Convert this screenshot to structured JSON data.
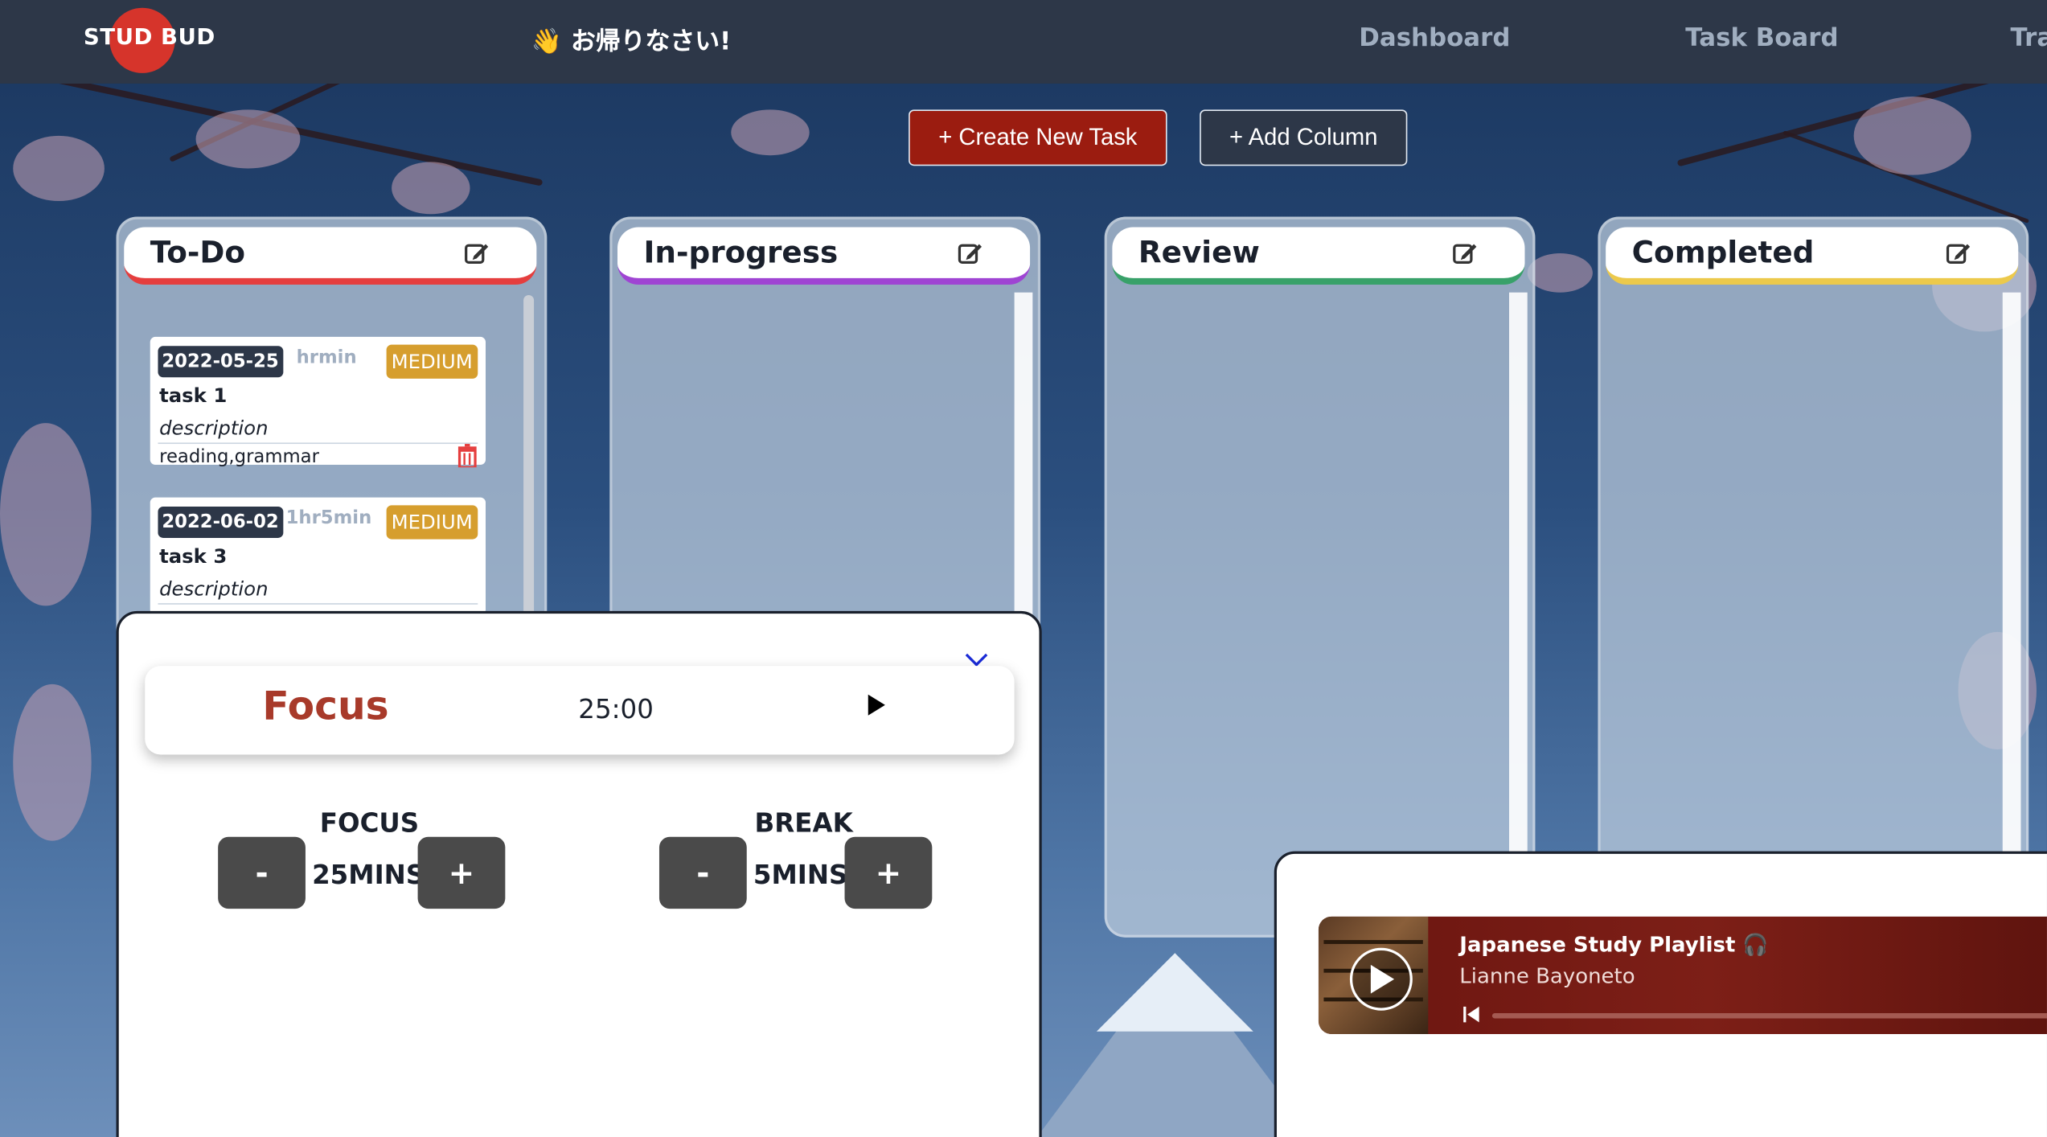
{
  "nav": {
    "logo": "STUD BUD",
    "welcome": "👋 お帰りなさい!",
    "links": [
      "Dashboard",
      "Task Board",
      "Tra"
    ]
  },
  "toolbar": {
    "create_label": "+ Create New Task",
    "add_column_label": "+ Add Column"
  },
  "columns": [
    {
      "title": "To-Do",
      "accent": "#e53e3e"
    },
    {
      "title": "In-progress",
      "accent": "#9f44d3"
    },
    {
      "title": "Review",
      "accent": "#38a169"
    },
    {
      "title": "Completed",
      "accent": "#ecc94b"
    }
  ],
  "tasks": [
    {
      "date": "2022-05-25",
      "duration": "hrmin",
      "priority": "MEDIUM",
      "name": "task 1",
      "description": "description",
      "tags": "reading,grammar"
    },
    {
      "date": "2022-06-02",
      "duration": "1hr5min",
      "priority": "MEDIUM",
      "name": "task 3",
      "description": "description",
      "tags": ""
    }
  ],
  "timer": {
    "mode": "Focus",
    "time": "25:00",
    "focus_label": "FOCUS",
    "focus_value": "25MINS",
    "break_label": "BREAK",
    "break_value": "5MINS",
    "minus": "-",
    "plus": "+",
    "icons": {
      "play": "play-icon",
      "collapse": "chevron-down-icon"
    }
  },
  "music": {
    "playlist": "Japanese Study Playlist 🎧",
    "artist": "Lianne Bayoneto",
    "icons": {
      "play": "play-circle-icon",
      "previous": "skip-back-icon"
    }
  },
  "colors": {
    "nav_bg": "#2d3748",
    "create_button": "#9b1c10",
    "add_column_button": "#2d3748",
    "focus_text": "#a83a2a",
    "priority_badge": "#d69e2e",
    "delete_icon": "#e53e3e"
  }
}
